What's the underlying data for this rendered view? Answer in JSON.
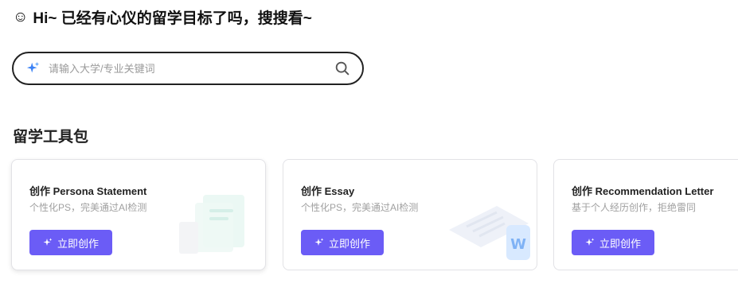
{
  "greeting": {
    "emoji": "☺",
    "text": "Hi~ 已经有心仪的留学目标了吗，搜搜看~"
  },
  "search": {
    "placeholder": "请输入大学/专业关键词",
    "value": ""
  },
  "toolkit": {
    "title": "留学工具包",
    "cards": [
      {
        "title": "创作 Persona Statement",
        "subtitle": "个性化PS，完美通过AI检测",
        "button": "立即创作"
      },
      {
        "title": "创作 Essay",
        "subtitle": "个性化PS，完美通过AI检测",
        "button": "立即创作"
      },
      {
        "title": "创作 Recommendation Letter",
        "subtitle": "基于个人经历创作，拒绝雷同",
        "button": "立即创作"
      }
    ]
  },
  "colors": {
    "accent": "#6b5cf6",
    "sparkle": "#3b82f6",
    "border": "#222222"
  },
  "icons": {
    "search": "search-icon",
    "sparkle": "sparkle-icon"
  }
}
